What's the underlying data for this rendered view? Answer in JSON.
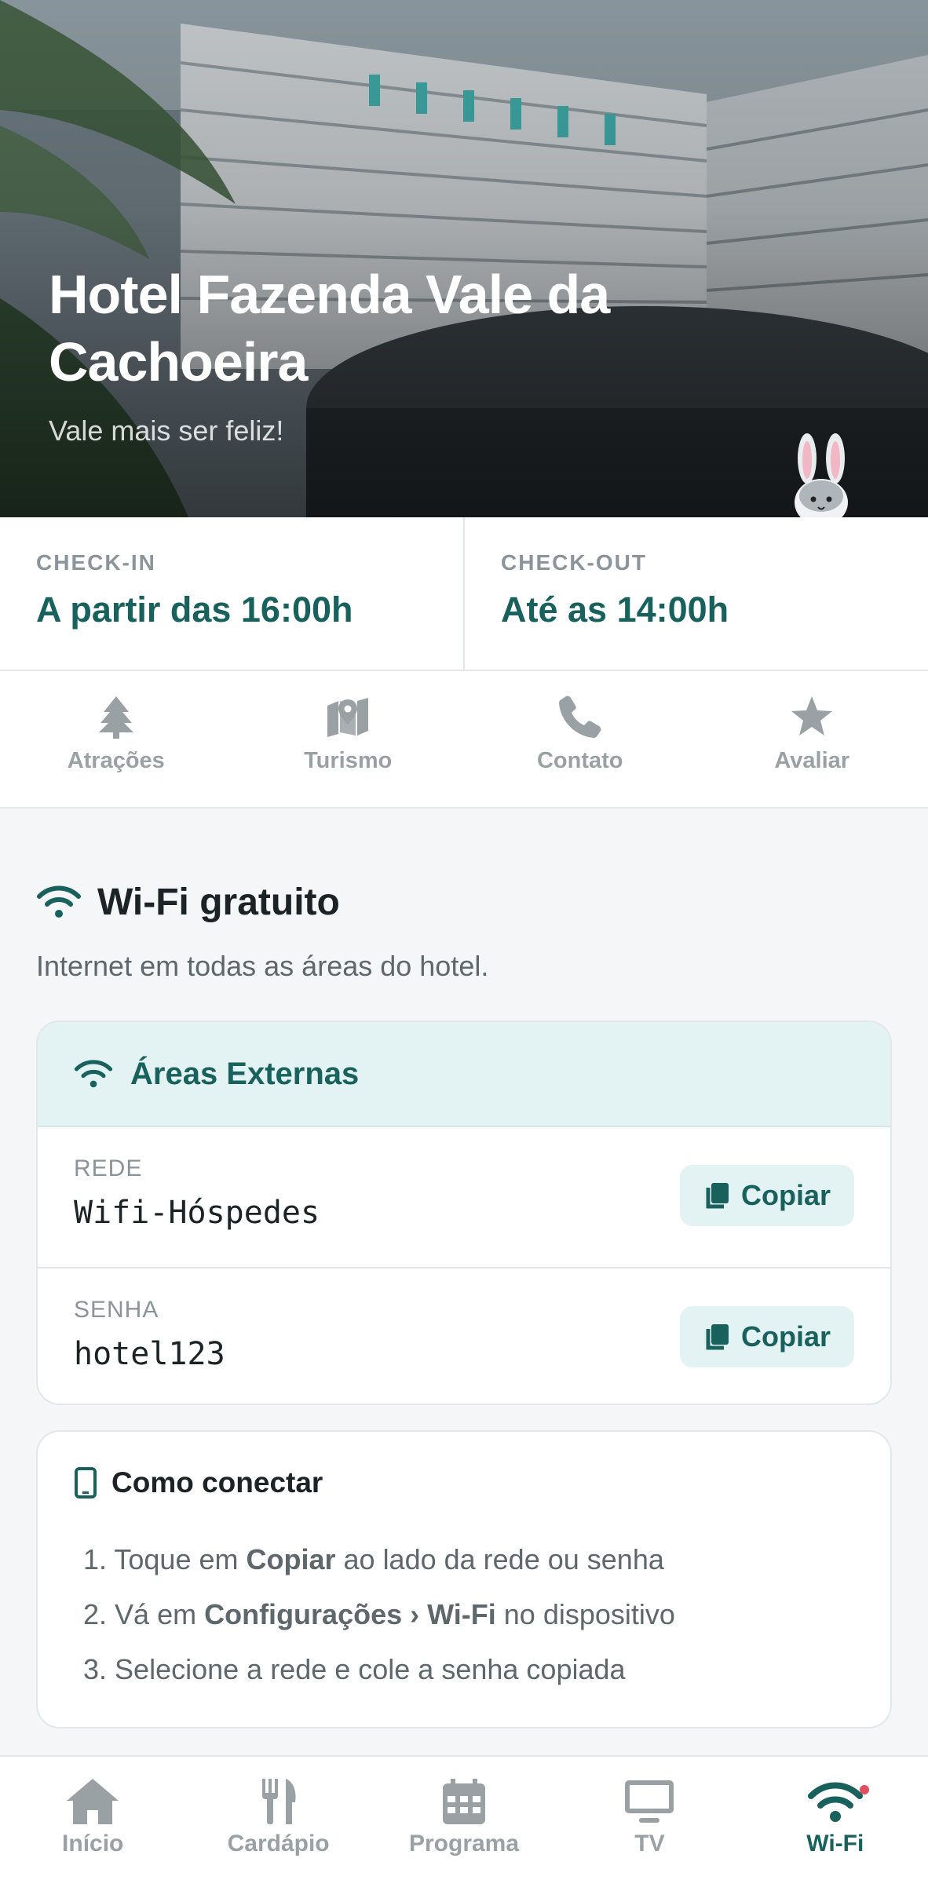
{
  "hero": {
    "title": "Hotel Fazenda Vale da Cachoeira",
    "tagline": "Vale mais ser feliz!",
    "mascot_icon": "bunny-icon"
  },
  "stay": {
    "checkin_label": "CHECK-IN",
    "checkin_value": "A partir das 16:00h",
    "checkout_label": "CHECK-OUT",
    "checkout_value": "Até as 14:00h"
  },
  "quick_nav": [
    {
      "label": "Atrações",
      "icon": "tree-icon"
    },
    {
      "label": "Turismo",
      "icon": "map-pin-icon"
    },
    {
      "label": "Contato",
      "icon": "phone-icon"
    },
    {
      "label": "Avaliar",
      "icon": "star-icon"
    }
  ],
  "wifi": {
    "title": "Wi-Fi gratuito",
    "description": "Internet em todas as áreas do hotel.",
    "network_card": {
      "title": "Áreas Externas",
      "network_label": "REDE",
      "network_value": "Wifi-Hóspedes",
      "password_label": "SENHA",
      "password_value": "hotel123",
      "copy_label": "Copiar"
    },
    "howto": {
      "title": "Como conectar",
      "steps": [
        {
          "n": "1.",
          "pre": "Toque em ",
          "bold": "Copiar",
          "post": " ao lado da rede ou senha"
        },
        {
          "n": "2.",
          "pre": "Vá em ",
          "bold": "Configurações › Wi-Fi",
          "post": " no dispositivo"
        },
        {
          "n": "3.",
          "pre": "Selecione a rede e cole a senha copiada",
          "bold": "",
          "post": ""
        }
      ]
    }
  },
  "bottom_nav": [
    {
      "label": "Início",
      "icon": "home-icon",
      "active": false
    },
    {
      "label": "Cardápio",
      "icon": "utensils-icon",
      "active": false
    },
    {
      "label": "Programa",
      "icon": "calendar-icon",
      "active": false
    },
    {
      "label": "TV",
      "icon": "tv-icon",
      "active": false
    },
    {
      "label": "Wi-Fi",
      "icon": "wifi-icon",
      "active": true
    }
  ],
  "colors": {
    "accent": "#19615d",
    "accent_light": "#e3f2f2",
    "muted": "#9aa1a5",
    "notification_dot": "#e04f5f"
  }
}
